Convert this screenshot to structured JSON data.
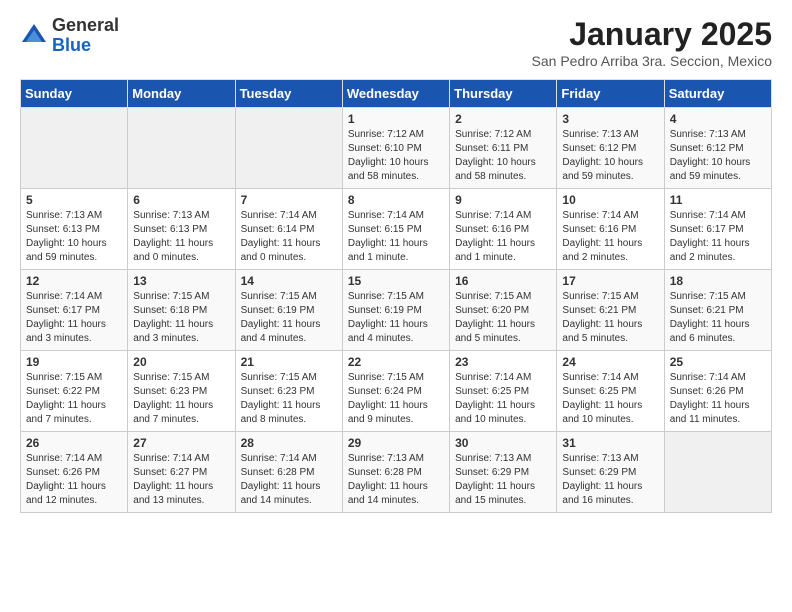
{
  "header": {
    "logo_general": "General",
    "logo_blue": "Blue",
    "month_year": "January 2025",
    "location": "San Pedro Arriba 3ra. Seccion, Mexico"
  },
  "days_of_week": [
    "Sunday",
    "Monday",
    "Tuesday",
    "Wednesday",
    "Thursday",
    "Friday",
    "Saturday"
  ],
  "weeks": [
    [
      {
        "day": "",
        "info": ""
      },
      {
        "day": "",
        "info": ""
      },
      {
        "day": "",
        "info": ""
      },
      {
        "day": "1",
        "info": "Sunrise: 7:12 AM\nSunset: 6:10 PM\nDaylight: 10 hours\nand 58 minutes."
      },
      {
        "day": "2",
        "info": "Sunrise: 7:12 AM\nSunset: 6:11 PM\nDaylight: 10 hours\nand 58 minutes."
      },
      {
        "day": "3",
        "info": "Sunrise: 7:13 AM\nSunset: 6:12 PM\nDaylight: 10 hours\nand 59 minutes."
      },
      {
        "day": "4",
        "info": "Sunrise: 7:13 AM\nSunset: 6:12 PM\nDaylight: 10 hours\nand 59 minutes."
      }
    ],
    [
      {
        "day": "5",
        "info": "Sunrise: 7:13 AM\nSunset: 6:13 PM\nDaylight: 10 hours\nand 59 minutes."
      },
      {
        "day": "6",
        "info": "Sunrise: 7:13 AM\nSunset: 6:13 PM\nDaylight: 11 hours\nand 0 minutes."
      },
      {
        "day": "7",
        "info": "Sunrise: 7:14 AM\nSunset: 6:14 PM\nDaylight: 11 hours\nand 0 minutes."
      },
      {
        "day": "8",
        "info": "Sunrise: 7:14 AM\nSunset: 6:15 PM\nDaylight: 11 hours\nand 1 minute."
      },
      {
        "day": "9",
        "info": "Sunrise: 7:14 AM\nSunset: 6:16 PM\nDaylight: 11 hours\nand 1 minute."
      },
      {
        "day": "10",
        "info": "Sunrise: 7:14 AM\nSunset: 6:16 PM\nDaylight: 11 hours\nand 2 minutes."
      },
      {
        "day": "11",
        "info": "Sunrise: 7:14 AM\nSunset: 6:17 PM\nDaylight: 11 hours\nand 2 minutes."
      }
    ],
    [
      {
        "day": "12",
        "info": "Sunrise: 7:14 AM\nSunset: 6:17 PM\nDaylight: 11 hours\nand 3 minutes."
      },
      {
        "day": "13",
        "info": "Sunrise: 7:15 AM\nSunset: 6:18 PM\nDaylight: 11 hours\nand 3 minutes."
      },
      {
        "day": "14",
        "info": "Sunrise: 7:15 AM\nSunset: 6:19 PM\nDaylight: 11 hours\nand 4 minutes."
      },
      {
        "day": "15",
        "info": "Sunrise: 7:15 AM\nSunset: 6:19 PM\nDaylight: 11 hours\nand 4 minutes."
      },
      {
        "day": "16",
        "info": "Sunrise: 7:15 AM\nSunset: 6:20 PM\nDaylight: 11 hours\nand 5 minutes."
      },
      {
        "day": "17",
        "info": "Sunrise: 7:15 AM\nSunset: 6:21 PM\nDaylight: 11 hours\nand 5 minutes."
      },
      {
        "day": "18",
        "info": "Sunrise: 7:15 AM\nSunset: 6:21 PM\nDaylight: 11 hours\nand 6 minutes."
      }
    ],
    [
      {
        "day": "19",
        "info": "Sunrise: 7:15 AM\nSunset: 6:22 PM\nDaylight: 11 hours\nand 7 minutes."
      },
      {
        "day": "20",
        "info": "Sunrise: 7:15 AM\nSunset: 6:23 PM\nDaylight: 11 hours\nand 7 minutes."
      },
      {
        "day": "21",
        "info": "Sunrise: 7:15 AM\nSunset: 6:23 PM\nDaylight: 11 hours\nand 8 minutes."
      },
      {
        "day": "22",
        "info": "Sunrise: 7:15 AM\nSunset: 6:24 PM\nDaylight: 11 hours\nand 9 minutes."
      },
      {
        "day": "23",
        "info": "Sunrise: 7:14 AM\nSunset: 6:25 PM\nDaylight: 11 hours\nand 10 minutes."
      },
      {
        "day": "24",
        "info": "Sunrise: 7:14 AM\nSunset: 6:25 PM\nDaylight: 11 hours\nand 10 minutes."
      },
      {
        "day": "25",
        "info": "Sunrise: 7:14 AM\nSunset: 6:26 PM\nDaylight: 11 hours\nand 11 minutes."
      }
    ],
    [
      {
        "day": "26",
        "info": "Sunrise: 7:14 AM\nSunset: 6:26 PM\nDaylight: 11 hours\nand 12 minutes."
      },
      {
        "day": "27",
        "info": "Sunrise: 7:14 AM\nSunset: 6:27 PM\nDaylight: 11 hours\nand 13 minutes."
      },
      {
        "day": "28",
        "info": "Sunrise: 7:14 AM\nSunset: 6:28 PM\nDaylight: 11 hours\nand 14 minutes."
      },
      {
        "day": "29",
        "info": "Sunrise: 7:13 AM\nSunset: 6:28 PM\nDaylight: 11 hours\nand 14 minutes."
      },
      {
        "day": "30",
        "info": "Sunrise: 7:13 AM\nSunset: 6:29 PM\nDaylight: 11 hours\nand 15 minutes."
      },
      {
        "day": "31",
        "info": "Sunrise: 7:13 AM\nSunset: 6:29 PM\nDaylight: 11 hours\nand 16 minutes."
      },
      {
        "day": "",
        "info": ""
      }
    ]
  ]
}
